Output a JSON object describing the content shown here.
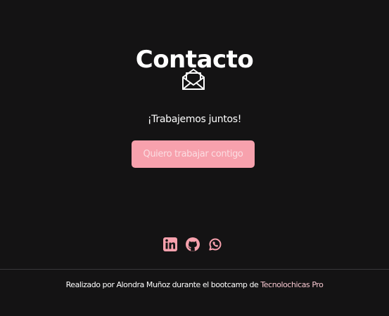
{
  "contact": {
    "title": "Contacto",
    "icon": "envelope-open-icon",
    "subtitle": "¡Trabajemos juntos!",
    "button_label": "Quiero trabajar contigo"
  },
  "social": {
    "icons": [
      "linkedin-icon",
      "github-icon",
      "whatsapp-icon"
    ],
    "color": "#f7a1ad"
  },
  "footer": {
    "text": "Realizado por Alondra Muñoz durante el bootcamp de",
    "link": "Tecnolochicas Pro",
    "link_color": "#f7c7d0"
  },
  "colors": {
    "background": "#141314",
    "accent": "#f7a1ad"
  }
}
